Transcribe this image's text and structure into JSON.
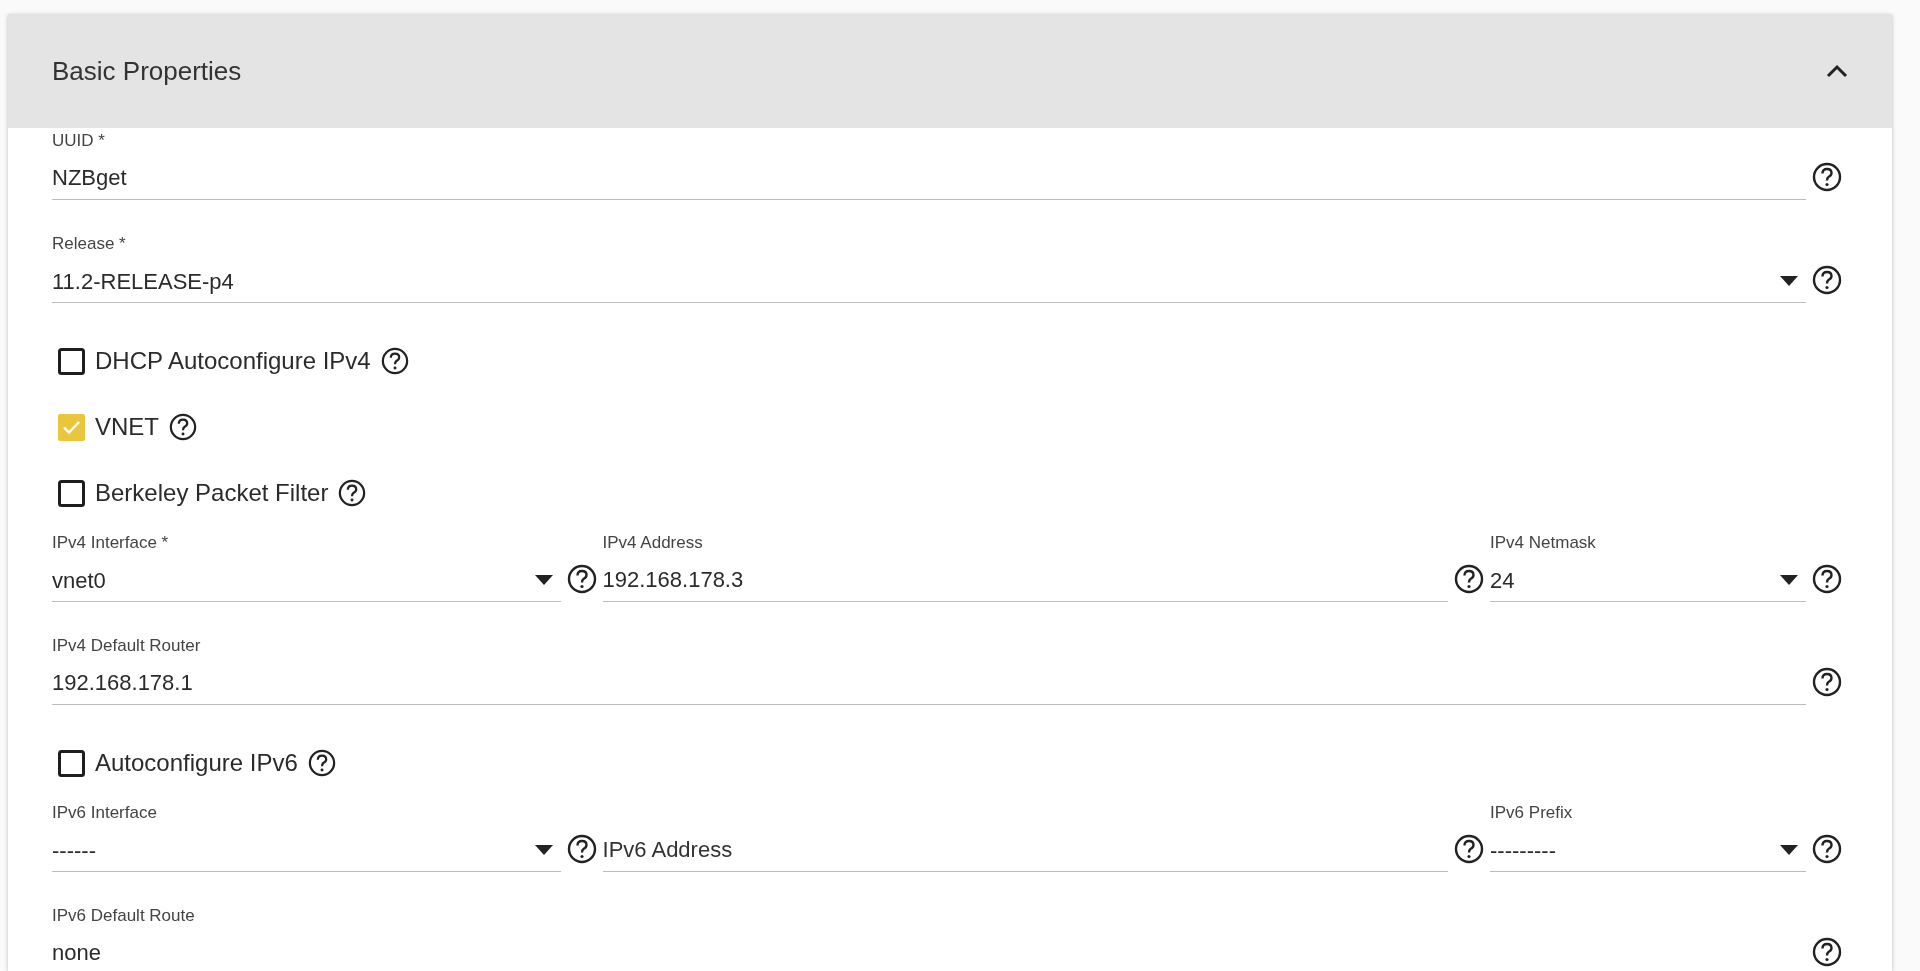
{
  "panel": {
    "title": "Basic Properties",
    "expanded": true
  },
  "rows": [
    {
      "kind": "fields",
      "fields": [
        {
          "kind": "input",
          "label": "UUID *",
          "value": "NZBget"
        }
      ]
    },
    {
      "kind": "fields",
      "fields": [
        {
          "kind": "select",
          "label": "Release *",
          "value": "11.2-RELEASE-p4"
        }
      ]
    },
    {
      "kind": "checkbox",
      "label": "DHCP Autoconfigure IPv4",
      "checked": false
    },
    {
      "kind": "checkbox",
      "label": "VNET",
      "checked": true
    },
    {
      "kind": "checkbox",
      "label": "Berkeley Packet Filter",
      "checked": false
    },
    {
      "kind": "fields",
      "fields": [
        {
          "kind": "select",
          "label": "IPv4 Interface *",
          "value": "vnet0"
        },
        {
          "kind": "input",
          "label": "IPv4 Address",
          "value": "192.168.178.3"
        },
        {
          "kind": "select",
          "label": "IPv4 Netmask",
          "value": "24"
        }
      ]
    },
    {
      "kind": "fields",
      "fields": [
        {
          "kind": "input",
          "label": "IPv4 Default Router",
          "value": "192.168.178.1"
        }
      ]
    },
    {
      "kind": "checkbox",
      "label": "Autoconfigure IPv6",
      "checked": false
    },
    {
      "kind": "fields",
      "fields": [
        {
          "kind": "select",
          "label": "IPv6 Interface",
          "value": "------"
        },
        {
          "kind": "input",
          "placeholder": "IPv6 Address"
        },
        {
          "kind": "select",
          "label": "IPv6 Prefix",
          "value": "---------"
        }
      ]
    },
    {
      "kind": "fields",
      "fields": [
        {
          "kind": "input",
          "label": "IPv6 Default Route",
          "value": "none"
        }
      ]
    }
  ]
}
